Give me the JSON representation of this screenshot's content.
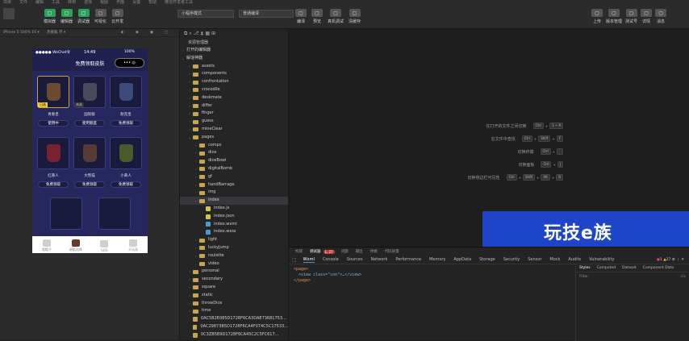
{
  "menu": [
    "项目",
    "文件",
    "编辑",
    "工具",
    "转到",
    "选择",
    "视图",
    "界面",
    "设置",
    "帮助",
    "微信开发者工具"
  ],
  "toolbar": {
    "left": [
      {
        "label": "模拟器",
        "icon": "phone-icon"
      },
      {
        "label": "编辑器",
        "icon": "code-icon"
      },
      {
        "label": "调试器",
        "icon": "bug-icon"
      },
      {
        "label": "可视化",
        "icon": "visual-icon"
      },
      {
        "label": "云开发",
        "icon": "cloud-icon"
      }
    ],
    "mode_select": "小程序模式",
    "compile_select": "普通编译",
    "center": [
      {
        "label": "编译",
        "icon": "refresh-icon"
      },
      {
        "label": "预览",
        "icon": "preview-icon"
      },
      {
        "label": "真机调试",
        "icon": "device-icon"
      },
      {
        "label": "清缓存",
        "icon": "clear-icon"
      }
    ],
    "right": [
      {
        "label": "上传",
        "icon": "upload-icon"
      },
      {
        "label": "版本管理",
        "icon": "branch-icon"
      },
      {
        "label": "测试号",
        "icon": "test-icon"
      },
      {
        "label": "详情",
        "icon": "detail-icon"
      },
      {
        "label": "消息",
        "icon": "bell-icon"
      }
    ]
  },
  "simulator": {
    "device": "iPhone 5 100% 16 ▾",
    "hot": "热重载 开 ▾",
    "status_time": "14:49",
    "status_carrier": "●●●●● WeChat令",
    "battery": "100%",
    "page_title": "免费领取皮肤",
    "items": [
      {
        "name": "青春皇",
        "badge": "已选",
        "btn": "使用中"
      },
      {
        "name": "国际服",
        "badge": "未选",
        "btn": "使用额度"
      },
      {
        "name": "耐克皇",
        "badge": "",
        "btn": "免费领取"
      },
      {
        "name": "红黄人",
        "badge": "",
        "btn": "免费领取"
      },
      {
        "name": "大熊猫",
        "badge": "",
        "btn": "免费领取"
      },
      {
        "name": "小黄人",
        "badge": "",
        "btn": "免费领取"
      }
    ],
    "tabs": [
      "我帽子",
      "调酷选择",
      "SOS",
      "大玩家"
    ]
  },
  "explorer": {
    "title": "资源管理器",
    "sections": [
      "打开的编辑器",
      "解谜神器"
    ],
    "tree": [
      {
        "label": "assets",
        "depth": 1,
        "type": "folder"
      },
      {
        "label": "components",
        "depth": 1,
        "type": "folder"
      },
      {
        "label": "confrontation",
        "depth": 1,
        "type": "folder"
      },
      {
        "label": "crocodile",
        "depth": 1,
        "type": "folder"
      },
      {
        "label": "deskmate",
        "depth": 1,
        "type": "folder"
      },
      {
        "label": "differ",
        "depth": 1,
        "type": "folder"
      },
      {
        "label": "finger",
        "depth": 1,
        "type": "folder"
      },
      {
        "label": "guess",
        "depth": 1,
        "type": "folder"
      },
      {
        "label": "mineClear",
        "depth": 1,
        "type": "folder"
      },
      {
        "label": "pages",
        "depth": 1,
        "type": "folder",
        "open": true
      },
      {
        "label": "comps",
        "depth": 2,
        "type": "folder"
      },
      {
        "label": "dice",
        "depth": 2,
        "type": "folder"
      },
      {
        "label": "diceBowl",
        "depth": 2,
        "type": "folder"
      },
      {
        "label": "digitalBomb",
        "depth": 2,
        "type": "folder"
      },
      {
        "label": "gf",
        "depth": 2,
        "type": "folder"
      },
      {
        "label": "handBarrage",
        "depth": 2,
        "type": "folder"
      },
      {
        "label": "img",
        "depth": 2,
        "type": "folder"
      },
      {
        "label": "index",
        "depth": 2,
        "type": "folder",
        "open": true,
        "selected": true
      },
      {
        "label": "index.js",
        "depth": 3,
        "type": "js"
      },
      {
        "label": "index.json",
        "depth": 3,
        "type": "json"
      },
      {
        "label": "index.wxml",
        "depth": 3,
        "type": "wxml"
      },
      {
        "label": "index.wxss",
        "depth": 3,
        "type": "wxss"
      },
      {
        "label": "light",
        "depth": 2,
        "type": "folder"
      },
      {
        "label": "luckyJump",
        "depth": 2,
        "type": "folder"
      },
      {
        "label": "roulette",
        "depth": 2,
        "type": "folder"
      },
      {
        "label": "video",
        "depth": 2,
        "type": "folder"
      },
      {
        "label": "personal",
        "depth": 1,
        "type": "folder"
      },
      {
        "label": "secondary",
        "depth": 1,
        "type": "folder"
      },
      {
        "label": "square",
        "depth": 1,
        "type": "folder"
      },
      {
        "label": "static",
        "depth": 1,
        "type": "folder"
      },
      {
        "label": "throwDice",
        "depth": 1,
        "type": "folder"
      },
      {
        "label": "time",
        "depth": 1,
        "type": "folder"
      },
      {
        "label": "0AC5B2E085D1728F6CA3DAE73681753...",
        "depth": 1,
        "type": "img"
      },
      {
        "label": "0AC29873B5D1728F6CA4F074C5C17533...",
        "depth": 1,
        "type": "img"
      },
      {
        "label": "0C3ZB5B9D1728F6CA45C2C5FC617...",
        "depth": 1,
        "type": "img"
      }
    ]
  },
  "shortcuts": [
    {
      "label": "在打开的文件之间切换",
      "keys": [
        "Ctrl",
        "1 ~ 9"
      ]
    },
    {
      "label": "在文件中查找",
      "keys": [
        "Ctrl",
        "Shift",
        "F"
      ]
    },
    {
      "label": "切换终端",
      "keys": [
        "Ctrl",
        "`"
      ]
    },
    {
      "label": "切换面板",
      "keys": [
        "Ctrl",
        "J"
      ]
    },
    {
      "label": "切换侧边栏可见性",
      "keys": [
        "Ctrl",
        "Shift",
        "Alt",
        "B"
      ]
    }
  ],
  "watermark": "玩技e族",
  "devtools": {
    "top_tabs": [
      "构建",
      "调试器",
      "问题",
      "输出",
      "终端",
      "代码质量"
    ],
    "badge": "1, 27",
    "tabs": [
      "Wxml",
      "Console",
      "Sources",
      "Network",
      "Performance",
      "Memory",
      "AppData",
      "Storage",
      "Security",
      "Sensor",
      "Mock",
      "Audits",
      "Vulnerability"
    ],
    "err": "1",
    "warn": "27",
    "code": [
      "<page>",
      "  <view class=\"con\">…</view>",
      "</page>"
    ],
    "style_tabs": [
      "Styles",
      "Computed",
      "Dataset",
      "Component Data"
    ],
    "filter": "Filter",
    "cls": ".cls"
  },
  "colors": {
    "accent": "#27a35a",
    "phone_bg": "#26275e",
    "watermark_bg": "#1c45c9"
  }
}
